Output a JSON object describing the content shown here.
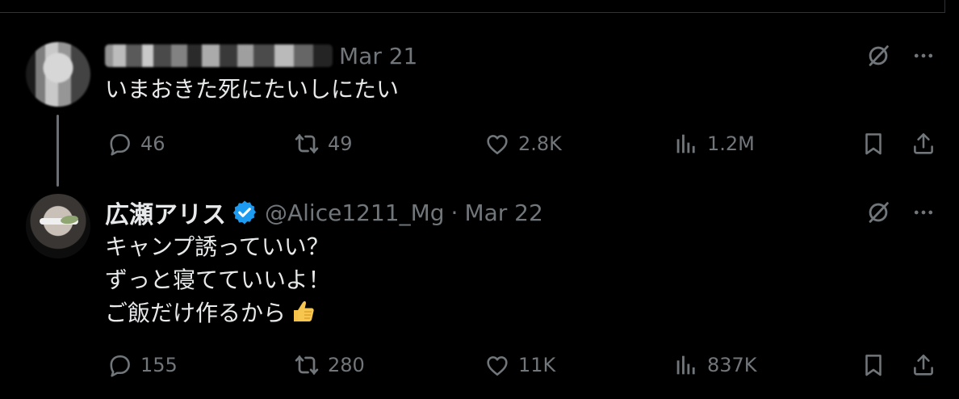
{
  "tweets": [
    {
      "display_name": "",
      "handle": "",
      "date": "Mar 21",
      "text": "いまおきた死にたいしにたい",
      "replies": "46",
      "reposts": "49",
      "likes": "2.8K",
      "views": "1.2M",
      "verified": false
    },
    {
      "display_name": "広瀬アリス",
      "handle": "@Alice1211_Mg",
      "separator": "·",
      "date": "Mar 22",
      "text": "キャンプ誘っていい？\nずっと寝てていいよ！\nご飯だけ作るから",
      "emoji": "thumbs-up",
      "replies": "155",
      "reposts": "280",
      "likes": "11K",
      "views": "837K",
      "verified": true
    }
  ],
  "colors": {
    "background": "#000000",
    "text": "#e7e9ea",
    "secondary_text": "#71767b",
    "verified": "#1d9bf0",
    "divider": "#2f3336"
  },
  "icons": {
    "grok": "grok-icon",
    "more": "more-icon",
    "reply": "reply-icon",
    "repost": "repost-icon",
    "like": "like-icon",
    "views": "views-icon",
    "bookmark": "bookmark-icon",
    "share": "share-icon"
  }
}
